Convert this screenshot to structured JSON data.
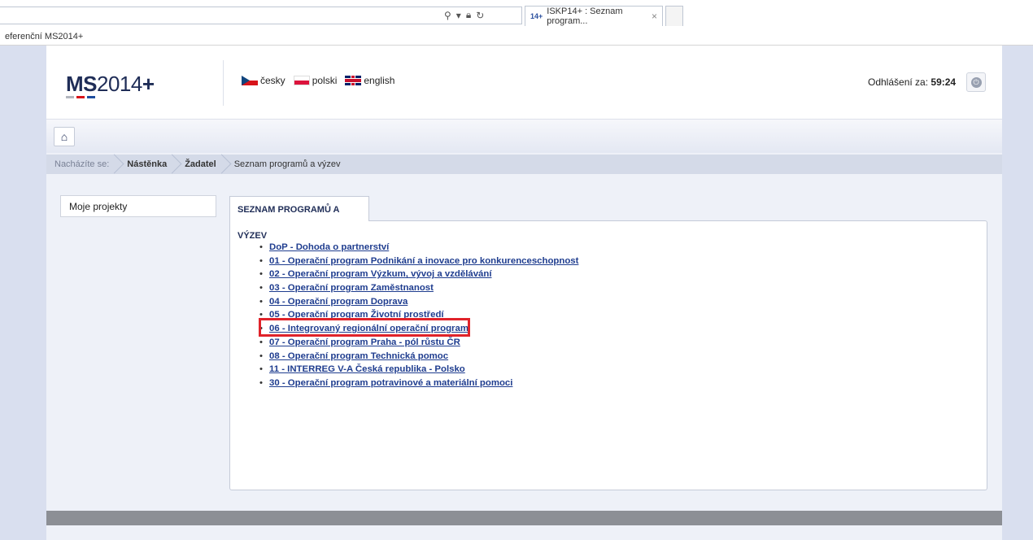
{
  "browser": {
    "tab_title": "ISKP14+ : Seznam program...",
    "tab_close": "×",
    "favorites_label": "eferenční MS2014+",
    "address_icons": [
      "search-icon",
      "dropdown-icon",
      "lock-icon",
      "refresh-icon"
    ]
  },
  "header": {
    "logo_prefix": "MS",
    "logo_year": "2014",
    "logo_plus": "+",
    "logo_bar_colors": [
      "#b3b6be",
      "#d7141a",
      "#1f4e9e"
    ],
    "languages": [
      {
        "label": "česky",
        "flag": "flag-cz"
      },
      {
        "label": "polski",
        "flag": "flag-pl"
      },
      {
        "label": "english",
        "flag": "flag-uk"
      }
    ],
    "logout_label": "Odhlášení za:",
    "logout_time": "59:24"
  },
  "toolbar": {
    "home_icon": "home-icon"
  },
  "breadcrumb": {
    "prefix": "Nacházíte se:",
    "items": [
      "Nástěnka",
      "Žadatel",
      "Seznam programů a výzev"
    ]
  },
  "sidebar": {
    "items": [
      {
        "label": "Moje projekty"
      }
    ]
  },
  "main": {
    "tab_label": "SEZNAM PROGRAMŮ A VÝZEV",
    "programs": [
      "DoP - Dohoda o partnerství",
      "01 - Operační program Podnikání a inovace pro konkurenceschopnost",
      "02 - Operační program Výzkum, vývoj a vzdělávání",
      "03 - Operační program Zaměstnanost",
      "04 - Operační program Doprava",
      "05 - Operační program Životní prostředí",
      "06 - Integrovaný regionální operační program",
      "07 - Operační program Praha - pól růstu ČR",
      "08 - Operační program Technická pomoc",
      "11 - INTERREG V-A Česká republika - Polsko",
      "30 - Operační program potravinové a materiální pomoci"
    ],
    "highlight_color": "#e0232a"
  }
}
